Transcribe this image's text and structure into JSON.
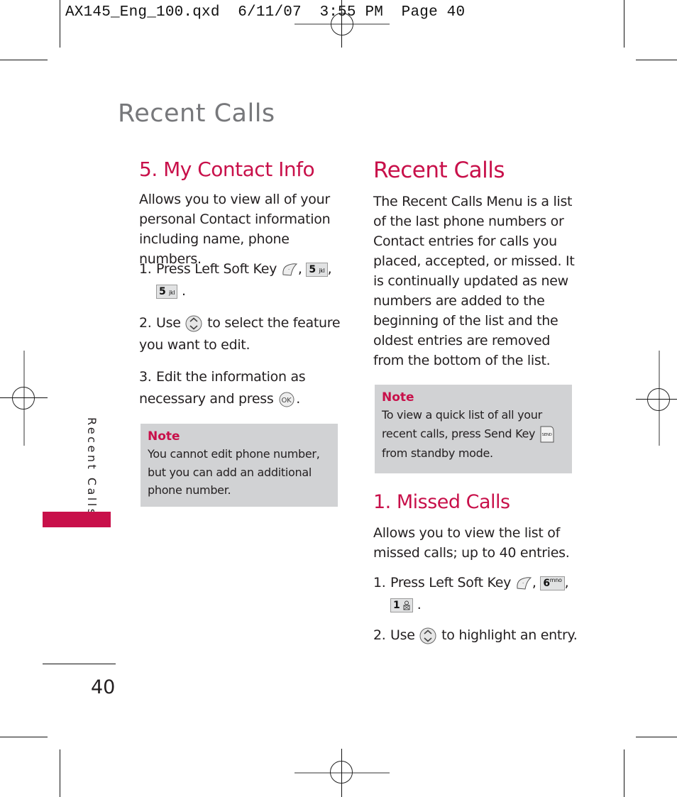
{
  "slug": "AX145_Eng_100.qxd  6/11/07  3:55 PM  Page 40",
  "running_title": "Recent Calls",
  "side_tab_label": "Recent Calls",
  "accent_color": "#c8104a",
  "note_bg_color": "#d1d2d4",
  "page_number": "40",
  "left": {
    "heading": "5. My Contact Info",
    "intro": "Allows you to view all of your personal Contact information including name, phone numbers.",
    "steps": [
      {
        "num": "1.",
        "text_before": "Press Left Soft Key",
        "keys": [
          "left-soft-key",
          "5 jkl",
          "5 jkl"
        ],
        "text_after": "."
      },
      {
        "num": "2.",
        "text_before": "Use",
        "keys": [
          "nav-up-down-key"
        ],
        "text_after": "to select the feature you want to edit."
      },
      {
        "num": "3.",
        "text_before": "Edit the information as necessary and press",
        "keys": [
          "ok-key"
        ],
        "text_after": "."
      }
    ],
    "note": {
      "title": "Note",
      "text": "You cannot edit phone number, but you can add an additional phone number."
    }
  },
  "right": {
    "heading": "Recent Calls",
    "intro": "The Recent Calls Menu is a list of the last phone numbers or Contact entries for calls you placed, accepted, or missed. It is continually updated as new numbers are added to the beginning of the list and the oldest entries are removed from the bottom of the list.",
    "note": {
      "title": "Note",
      "text_before": "To view a quick list of all your recent calls, press Send Key",
      "text_after": "from standby mode.",
      "key": "send-key"
    },
    "missed": {
      "heading": "1. Missed Calls",
      "intro": "Allows you to view the list of missed calls; up to 40 entries.",
      "steps": [
        {
          "num": "1.",
          "text_before": "Press Left Soft Key",
          "keys": [
            "left-soft-key",
            "6 mno",
            "1 voicemail"
          ],
          "text_after": "."
        },
        {
          "num": "2.",
          "text_before": "Use",
          "keys": [
            "nav-up-down-key"
          ],
          "text_after": "to highlight an entry."
        }
      ]
    }
  },
  "keys": {
    "five_main": "5",
    "five_sub": "jkl",
    "six_main": "6",
    "six_sub": "mno",
    "one_main": "1",
    "ok_label": "OK",
    "send_label": "SEND"
  }
}
